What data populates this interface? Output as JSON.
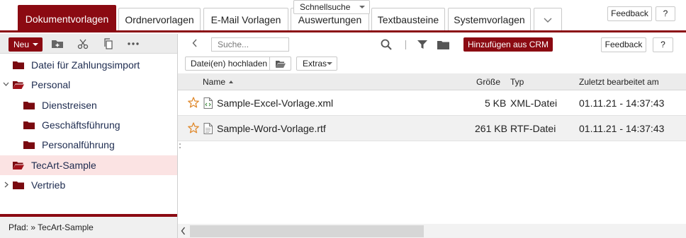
{
  "tabs": [
    {
      "label": "Dokumentvorlagen",
      "active": true
    },
    {
      "label": "Ordnervorlagen",
      "active": false
    },
    {
      "label": "E-Mail Vorlagen",
      "active": false
    },
    {
      "label": "Auswertungen",
      "active": false
    },
    {
      "label": "Textbausteine",
      "active": false
    },
    {
      "label": "Systemvorlagen",
      "active": false
    }
  ],
  "top_actions": {
    "feedback_label": "Feedback",
    "help_label": "?"
  },
  "left_toolbar": {
    "new_label": "Neu"
  },
  "tree": [
    {
      "label": "Datei für Zahlungsimport",
      "level": 0,
      "expander": "",
      "open": false,
      "selected": false
    },
    {
      "label": "Personal",
      "level": 0,
      "expander": "˅",
      "open": true,
      "selected": false
    },
    {
      "label": "Dienstreisen",
      "level": 1,
      "expander": "",
      "open": false,
      "selected": false
    },
    {
      "label": "Geschäftsführung",
      "level": 1,
      "expander": "",
      "open": false,
      "selected": false
    },
    {
      "label": "Personalführung",
      "level": 1,
      "expander": "",
      "open": false,
      "selected": false
    },
    {
      "label": "TecArt-Sample",
      "level": 0,
      "expander": "",
      "open": true,
      "selected": true
    },
    {
      "label": "Vertrieb",
      "level": 0,
      "expander": "›",
      "open": false,
      "selected": false
    }
  ],
  "path": {
    "text": "Pfad: » TecArt-Sample"
  },
  "right_toolbar": {
    "search_placeholder": "Suche...",
    "quicksearch_label": "Schnellsuche",
    "crm_button_label": "Hinzufügen aus CRM",
    "feedback_label": "Feedback",
    "help_label": "?",
    "upload_label": "Datei(en) hochladen",
    "extras_label": "Extras"
  },
  "table": {
    "columns": {
      "name": "Name",
      "size": "Größe",
      "type": "Typ",
      "modified": "Zuletzt bearbeitet am"
    },
    "rows": [
      {
        "name": "Sample-Excel-Vorlage.xml",
        "size": "5 KB",
        "type": "XML-Datei",
        "modified": "01.11.21 - 14:37:43",
        "icon": "xml-file-icon"
      },
      {
        "name": "Sample-Word-Vorlage.rtf",
        "size": "261 KB",
        "type": "RTF-Datei",
        "modified": "01.11.21 - 14:37:43",
        "icon": "text-file-icon"
      }
    ]
  },
  "colors": {
    "accent": "#8b0a12",
    "selection": "#fbe3e3",
    "folder": "#7a0a10",
    "star": "#e08a2e",
    "text_link": "#1d2b4f"
  }
}
